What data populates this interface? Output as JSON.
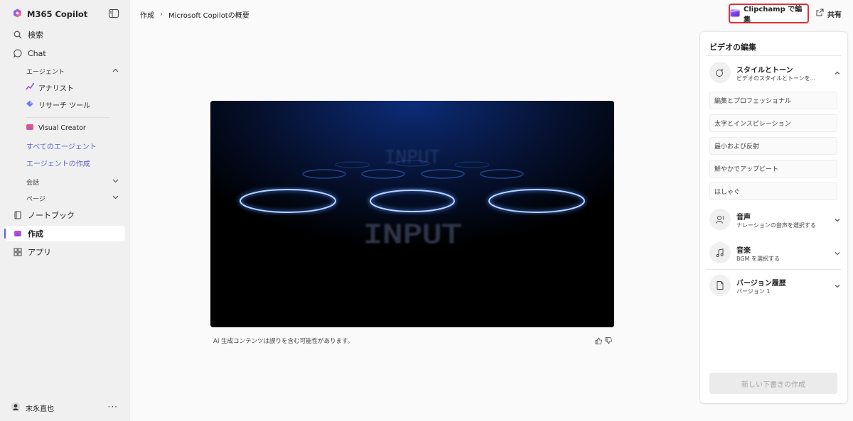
{
  "app": {
    "title": "M365 Copilot"
  },
  "nav": {
    "search": "検索",
    "chat": "Chat",
    "agents_section": "エージェント",
    "agents": [
      {
        "label": "アナリスト",
        "icon": "analyst-icon"
      },
      {
        "label": "リサーチ ツール",
        "icon": "researcher-icon"
      },
      {
        "label": "Visual Creator",
        "icon": "visual-creator-icon"
      }
    ],
    "all_agents": "すべてのエージェント",
    "create_agent": "エージェントの作成",
    "conversations_section": "会話",
    "pages_section": "ページ",
    "notebooks": "ノートブック",
    "create": "作成",
    "apps": "アプリ"
  },
  "user": {
    "name": "末永直也",
    "more": "···"
  },
  "breadcrumb": {
    "parent": "作成",
    "separator": "›",
    "current": "Microsoft Copilotの概要"
  },
  "header": {
    "clipchamp_label": "Clipchamp で編集",
    "share_label": "共有"
  },
  "video": {
    "text": "INPUT"
  },
  "ai_note": "AI 生成コンテンツは誤りを含む可能性があります。",
  "panel": {
    "title": "ビデオの編集",
    "style": {
      "title": "スタイルとトーン",
      "subtitle": "ビデオのスタイルとトーンを..."
    },
    "style_options": [
      "編集とプロフェッショナル",
      "太字とインスピレーション",
      "最小および反射",
      "鮮やかでアップビート",
      "はしゃぐ"
    ],
    "voice": {
      "title": "音声",
      "subtitle": "ナレーションの音声を選択する"
    },
    "music": {
      "title": "音楽",
      "subtitle": "BGM を選択する"
    },
    "history": {
      "title": "バージョン履歴",
      "subtitle": "バージョン 1"
    },
    "new_draft": "新しい下書きの作成"
  },
  "colors": {
    "accent": "#5b5fc7",
    "highlight": "#e0303a",
    "glow": "#4a8cff"
  }
}
